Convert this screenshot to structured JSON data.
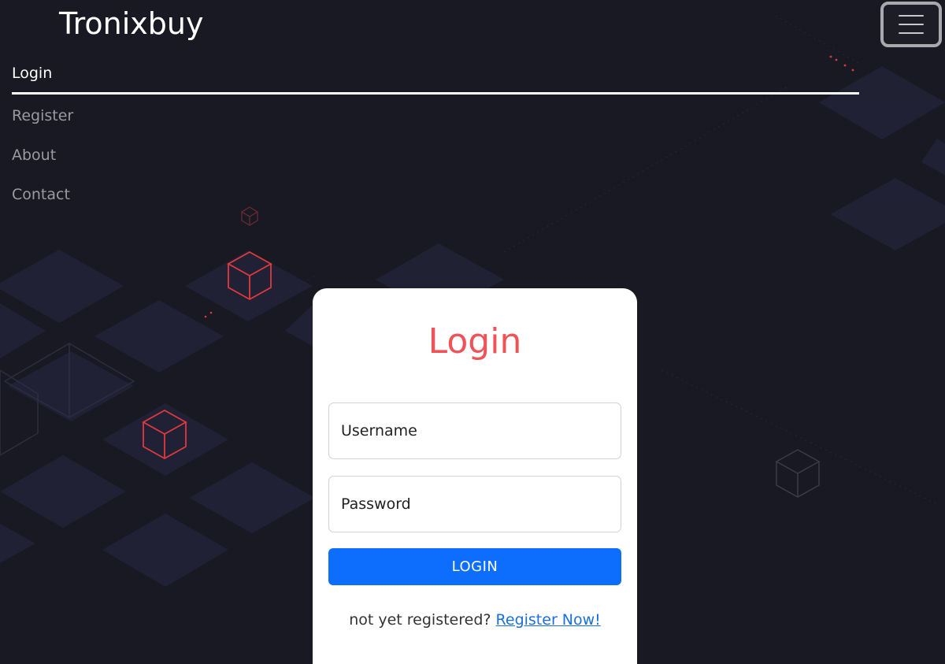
{
  "navbar": {
    "brand": "Tronixbuy",
    "toggler_icon": "hamburger-icon",
    "items": [
      {
        "label": "Login",
        "active": true
      },
      {
        "label": "Register",
        "active": false
      },
      {
        "label": "About",
        "active": false
      },
      {
        "label": "Contact",
        "active": false
      }
    ]
  },
  "login": {
    "title": "Login",
    "username_placeholder": "Username",
    "password_placeholder": "Password",
    "submit_label": "LOGIN",
    "prompt_text": "not yet registered?",
    "register_link": "Register Now!"
  },
  "colors": {
    "background": "#181923",
    "title": "#ef5358",
    "button": "#0d6efd",
    "link": "#1a6fe0",
    "cube_outline": "#e0393e"
  }
}
